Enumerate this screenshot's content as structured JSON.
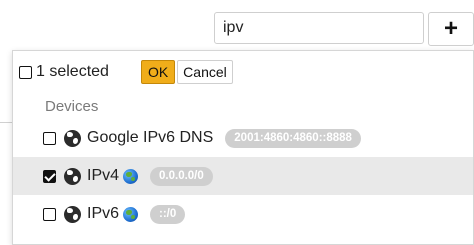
{
  "search": {
    "value": "ipv",
    "add_label": "+"
  },
  "dropdown": {
    "selected_count": "1 selected",
    "ok_label": "OK",
    "cancel_label": "Cancel",
    "group": "Devices",
    "items": [
      {
        "label": "Google IPv6 DNS",
        "badge": "2001:4860:4860::8888",
        "checked": false,
        "earth_icon": false
      },
      {
        "label": "IPv4",
        "badge": "0.0.0.0/0",
        "checked": true,
        "earth_icon": true
      },
      {
        "label": "IPv6",
        "badge": "::/0",
        "checked": false,
        "earth_icon": true
      }
    ]
  },
  "colors": {
    "ok_accent": "#f0ad1a",
    "badge_bg": "#cfcfcf",
    "active_row_bg": "#e9e9e9",
    "group_text": "#7a7a7a"
  },
  "icons": {
    "item_type": "globe-icon",
    "region": "earth-icon",
    "add": "plus-icon"
  }
}
